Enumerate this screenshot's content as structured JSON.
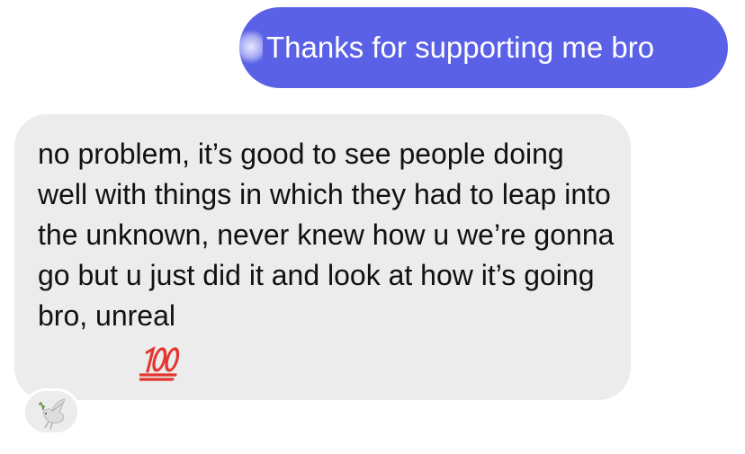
{
  "messages": {
    "sent": {
      "text": "Thanks for supporting me bro"
    },
    "received": {
      "text": "no problem, it’s good to see people doing well with things in which they had to leap into the unknown, never knew how u we’re gonna go but u just did it and look at how it’s going bro, unreal",
      "emoji": "hundred-points-icon"
    }
  },
  "reaction": {
    "icon": "dove-icon"
  },
  "colors": {
    "sent_bubble": "#5b61e6",
    "received_bubble": "#ececed",
    "emoji_red": "#e3352e"
  }
}
